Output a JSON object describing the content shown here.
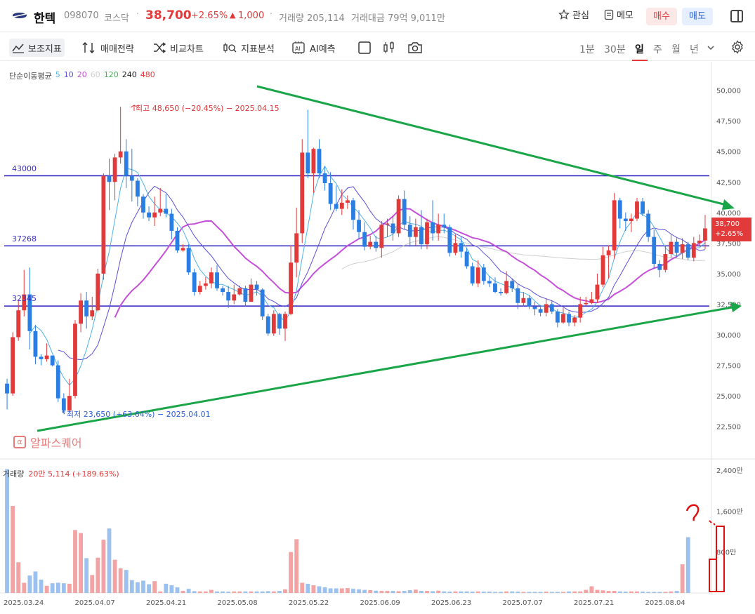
{
  "header": {
    "name": "한텍",
    "code": "098070",
    "market": "코스닥",
    "price": "38,700",
    "change_pct": "+2.65%",
    "change_arrow": "▲",
    "change_abs": "1,000",
    "volume_text": "거래량 205,114",
    "amount_text": "거래대금 79억 9,011만",
    "watch_label": "관심",
    "memo_label": "메모",
    "buy_label": "매수",
    "sell_label": "매도"
  },
  "toolbar": {
    "indicator_label": "보조지표",
    "strategy_label": "매매전략",
    "compare_label": "비교차트",
    "analysis_label": "지표분석",
    "ai_label": "AI예측",
    "periods": [
      "1분",
      "30분",
      "일",
      "주",
      "월",
      "년"
    ],
    "active_period": "일"
  },
  "ma_legend": {
    "title": "단순이동평균",
    "items": [
      {
        "label": "5",
        "color": "#4fb3e8"
      },
      {
        "label": "10",
        "color": "#5a4fd8"
      },
      {
        "label": "20",
        "color": "#c54fd8"
      },
      {
        "label": "60",
        "color": "#cfcfcf"
      },
      {
        "label": "120",
        "color": "#3cb54a"
      },
      {
        "label": "240",
        "color": "#222222"
      },
      {
        "label": "480",
        "color": "#e23a3a"
      }
    ]
  },
  "annotations": {
    "high_note": "최고 48,650 (−20.45%) − 2025.04.15",
    "low_note": "최저 23,650 (+63.64%) − 2025.04.01",
    "line_43000": "43000",
    "line_37268": "37268",
    "line_32345": "32345",
    "watermark": "알파스퀘어",
    "last_price": "38,700",
    "last_pct": "+2.65%"
  },
  "volume_legend": {
    "title": "거래량",
    "value": "20만 5,114 (+189.63%)"
  },
  "colors": {
    "up": "#e23a3a",
    "down": "#2a7de1",
    "trend": "#1aa648",
    "hline": "#2a1fc0"
  },
  "chart_data": {
    "type": "candlestick",
    "price_axis": {
      "ticks": [
        "50,000",
        "47,500",
        "45,000",
        "42,500",
        "40,000",
        "37,500",
        "35,000",
        "32,500",
        "30,000",
        "27,500",
        "25,000",
        "22,500"
      ],
      "range": [
        21200,
        51200
      ]
    },
    "volume_axis": {
      "ticks": [
        "2,400만",
        "1,600만",
        "800만"
      ],
      "range": [
        0,
        2400
      ]
    },
    "dates": [
      "2025.03.24",
      "2025.04.07",
      "2025.04.21",
      "2025.05.08",
      "2025.05.22",
      "2025.06.09",
      "2025.06.23",
      "2025.07.07",
      "2025.07.21",
      "2025.08.04"
    ],
    "candles": [
      [
        26000,
        25200,
        23900,
        26400
      ],
      [
        25200,
        29800,
        25000,
        30200
      ],
      [
        29800,
        32000,
        29500,
        32800
      ],
      [
        32000,
        33300,
        31500,
        35300
      ],
      [
        33300,
        30300,
        28800,
        35500
      ],
      [
        30300,
        28200,
        27600,
        30800
      ],
      [
        28200,
        28000,
        27500,
        28400
      ],
      [
        28000,
        28300,
        27800,
        29300
      ],
      [
        28300,
        27500,
        27400,
        28300
      ],
      [
        27500,
        24800,
        24500,
        27900
      ],
      [
        24800,
        23800,
        23650,
        25200
      ],
      [
        23800,
        25000,
        23700,
        26400
      ],
      [
        25000,
        30900,
        24800,
        31200
      ],
      [
        30900,
        32800,
        30200,
        33400
      ],
      [
        32800,
        31500,
        30500,
        33500
      ],
      [
        31500,
        32000,
        31200,
        33100
      ],
      [
        32000,
        35000,
        31900,
        35400
      ],
      [
        35000,
        43000,
        34500,
        43200
      ],
      [
        43000,
        42500,
        40200,
        44400
      ],
      [
        42500,
        44500,
        41000,
        44800
      ],
      [
        44500,
        45000,
        44000,
        48650
      ],
      [
        45000,
        43000,
        42000,
        46000
      ],
      [
        43000,
        42600,
        40900,
        45200
      ],
      [
        42600,
        41300,
        40500,
        42800
      ],
      [
        41300,
        40000,
        39500,
        41500
      ],
      [
        40000,
        39600,
        39300,
        40500
      ],
      [
        39600,
        40000,
        38900,
        41300
      ],
      [
        40000,
        40300,
        39700,
        42000
      ],
      [
        40300,
        39900,
        39600,
        41500
      ],
      [
        39900,
        38500,
        37800,
        40300
      ],
      [
        38500,
        36900,
        36700,
        38800
      ],
      [
        36900,
        37100,
        36800,
        37400
      ],
      [
        37100,
        35100,
        34900,
        37400
      ],
      [
        35100,
        33500,
        33200,
        35400
      ],
      [
        33500,
        34000,
        33300,
        34400
      ],
      [
        34000,
        34200,
        33700,
        34700
      ],
      [
        34200,
        35100,
        33800,
        35500
      ],
      [
        35100,
        33800,
        33600,
        35700
      ],
      [
        33800,
        33500,
        33200,
        34000
      ],
      [
        33500,
        32800,
        32200,
        34000
      ],
      [
        32800,
        33300,
        32500,
        34100
      ],
      [
        33300,
        33800,
        33200,
        34000
      ],
      [
        33800,
        32700,
        32300,
        34000
      ],
      [
        32700,
        34100,
        32700,
        34600
      ],
      [
        34100,
        33700,
        33200,
        34400
      ],
      [
        33700,
        31500,
        31200,
        33800
      ],
      [
        31500,
        30100,
        29900,
        31700
      ],
      [
        30100,
        31700,
        29900,
        32000
      ],
      [
        31700,
        30500,
        30000,
        31800
      ],
      [
        30500,
        31700,
        29500,
        31900
      ],
      [
        31700,
        35900,
        31600,
        37300
      ],
      [
        35900,
        38300,
        34700,
        40400
      ],
      [
        38300,
        44900,
        37500,
        46000
      ],
      [
        44900,
        43200,
        42800,
        48400
      ],
      [
        43200,
        45200,
        41600,
        45300
      ],
      [
        45200,
        43200,
        42800,
        46000
      ],
      [
        43200,
        42400,
        41800,
        43800
      ],
      [
        42400,
        40700,
        40200,
        43300
      ],
      [
        40700,
        40300,
        40100,
        42200
      ],
      [
        40300,
        40800,
        39800,
        41900
      ],
      [
        40800,
        41000,
        40300,
        41400
      ],
      [
        41000,
        39400,
        38600,
        41200
      ],
      [
        39400,
        38400,
        37800,
        40200
      ],
      [
        38400,
        37200,
        36900,
        39200
      ],
      [
        37200,
        37600,
        37000,
        38100
      ],
      [
        37600,
        37100,
        36800,
        38100
      ],
      [
        37100,
        39000,
        36300,
        39300
      ],
      [
        39000,
        39100,
        38000,
        39500
      ],
      [
        39100,
        38300,
        37700,
        39700
      ],
      [
        38300,
        41100,
        38000,
        41400
      ],
      [
        41100,
        39000,
        38600,
        41800
      ],
      [
        39000,
        38000,
        37200,
        39700
      ],
      [
        38000,
        38800,
        37300,
        39500
      ],
      [
        38800,
        37400,
        37000,
        40200
      ],
      [
        37400,
        39200,
        37000,
        39500
      ],
      [
        39200,
        38300,
        37700,
        41000
      ],
      [
        38300,
        39000,
        37700,
        39900
      ],
      [
        39000,
        38800,
        38300,
        39900
      ],
      [
        38800,
        36700,
        36400,
        39000
      ],
      [
        36700,
        37500,
        36500,
        38200
      ],
      [
        37500,
        36800,
        36300,
        38000
      ],
      [
        36800,
        35600,
        35400,
        37100
      ],
      [
        35600,
        34200,
        34000,
        35900
      ],
      [
        34200,
        35500,
        33900,
        36100
      ],
      [
        35500,
        34400,
        34100,
        35800
      ],
      [
        34400,
        34200,
        33900,
        34800
      ],
      [
        34200,
        33500,
        33400,
        34700
      ],
      [
        33500,
        33400,
        33200,
        33800
      ],
      [
        33400,
        34400,
        33300,
        35200
      ],
      [
        34400,
        33800,
        33500,
        34600
      ],
      [
        33800,
        32600,
        32100,
        34100
      ],
      [
        32600,
        33000,
        32300,
        33500
      ],
      [
        33000,
        32300,
        32100,
        33200
      ],
      [
        32300,
        32100,
        31600,
        32700
      ],
      [
        32100,
        31800,
        31500,
        32400
      ],
      [
        31800,
        32500,
        31500,
        33000
      ],
      [
        32500,
        31900,
        31700,
        32800
      ],
      [
        31900,
        31000,
        30600,
        32100
      ],
      [
        31000,
        31700,
        30900,
        32200
      ],
      [
        31700,
        31000,
        30700,
        31900
      ],
      [
        31000,
        31400,
        30700,
        31600
      ],
      [
        31400,
        32500,
        31000,
        33100
      ],
      [
        32500,
        32600,
        32400,
        33100
      ],
      [
        32600,
        32900,
        32500,
        33500
      ],
      [
        32900,
        34100,
        32600,
        35000
      ],
      [
        34100,
        36500,
        33900,
        37200
      ],
      [
        36500,
        36900,
        34600,
        37300
      ],
      [
        36900,
        41000,
        36200,
        41600
      ],
      [
        41000,
        39500,
        38700,
        41200
      ],
      [
        39500,
        39300,
        38500,
        40000
      ],
      [
        39300,
        39500,
        38400,
        39900
      ],
      [
        39500,
        40900,
        39300,
        41200
      ],
      [
        40900,
        39900,
        39700,
        41200
      ],
      [
        39900,
        38000,
        37600,
        40200
      ],
      [
        38000,
        35800,
        35400,
        38600
      ],
      [
        35800,
        35300,
        34700,
        36100
      ],
      [
        35300,
        36600,
        35100,
        37300
      ],
      [
        36600,
        37600,
        36300,
        38200
      ],
      [
        37600,
        36700,
        36300,
        37900
      ],
      [
        36700,
        37400,
        36200,
        37900
      ],
      [
        37400,
        36300,
        36100,
        37600
      ],
      [
        36300,
        37500,
        36000,
        38000
      ],
      [
        37500,
        37700,
        37200,
        38200
      ],
      [
        37700,
        38700,
        37000,
        39800
      ]
    ],
    "volume": [
      2420,
      1700,
      600,
      200,
      340,
      420,
      260,
      140,
      190,
      200,
      190,
      180,
      1230,
      1170,
      680,
      350,
      690,
      1040,
      1260,
      650,
      480,
      450,
      250,
      210,
      240,
      170,
      230,
      30,
      180,
      150,
      110,
      40,
      80,
      35,
      30,
      30,
      60,
      30,
      30,
      25,
      30,
      30,
      30,
      30,
      30,
      30,
      35,
      30,
      40,
      70,
      800,
      1050,
      200,
      180,
      150,
      130,
      110,
      90,
      90,
      90,
      95,
      80,
      70,
      60,
      55,
      45,
      40,
      40,
      40,
      35,
      40,
      55,
      65,
      40,
      40,
      35,
      45,
      30,
      25,
      30,
      30,
      30,
      25,
      30,
      25,
      25,
      20,
      20,
      30,
      30,
      25,
      20,
      20,
      20,
      20,
      25,
      20,
      20,
      20,
      30,
      30,
      30,
      60,
      130,
      60,
      50,
      40,
      40,
      30,
      25,
      30,
      30,
      25,
      20,
      20,
      20,
      20,
      30,
      40,
      560,
      1090
    ]
  }
}
